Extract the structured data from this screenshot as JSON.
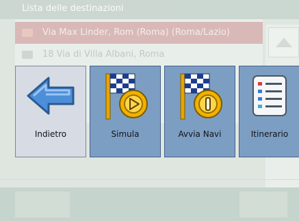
{
  "background": {
    "title": "Lista delle destinazioni",
    "rows": [
      {
        "text": "Via Max Linder, Rom (Roma) (Roma/Lazio)",
        "selected": true
      },
      {
        "text": "18 Via di Villa Albani, Roma",
        "selected": false
      }
    ]
  },
  "toolbar": {
    "buttons": [
      {
        "label": "Indietro",
        "icon": "back-arrow-icon"
      },
      {
        "label": "Simula",
        "icon": "checkered-flag-play-icon"
      },
      {
        "label": "Avvia Navi",
        "icon": "checkered-flag-start-icon"
      },
      {
        "label": "Itinerario",
        "icon": "itinerary-list-icon"
      }
    ]
  },
  "colors": {
    "toolbar_button": "#7d9ec3",
    "back_button": "#d7dbe3",
    "arrow": "#4c8fd8",
    "flag_pole": "#e8a400",
    "medallion": "#f0b200"
  }
}
